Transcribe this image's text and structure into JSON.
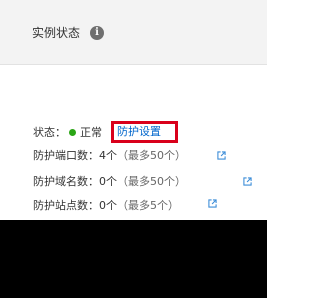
{
  "header": {
    "title": "实例状态",
    "info_icon": "info-icon"
  },
  "status": {
    "label": "状态：",
    "value": "正常",
    "dot_color": "#2aa515",
    "link_label": "防护设置"
  },
  "quotas": [
    {
      "label": "防护端口数：",
      "count": "4个",
      "limit": "（最多50个）",
      "icon": "external-link-icon"
    },
    {
      "label": "防护域名数：",
      "count": "0个",
      "limit": "（最多50个）",
      "icon": "external-link-icon"
    },
    {
      "label": "防护站点数：",
      "count": "0个",
      "limit": "（最多5个）",
      "icon": "external-link-icon"
    }
  ],
  "colors": {
    "link": "#0066cc",
    "highlight_box": "#d9001b",
    "external_icon": "#3c8dd8"
  }
}
